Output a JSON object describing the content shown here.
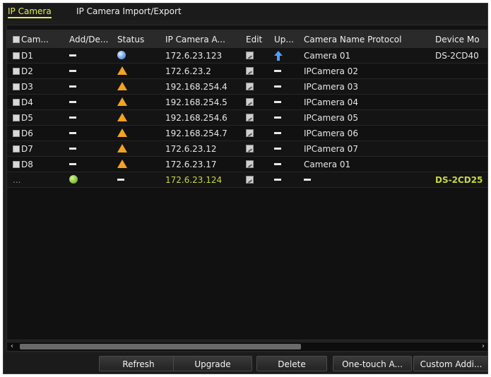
{
  "tabs": [
    {
      "label": "IP Camera",
      "active": true
    },
    {
      "label": "IP Camera Import/Export",
      "active": false
    }
  ],
  "table": {
    "headers": {
      "camera": "Cam...",
      "add_delete": "Add/De...",
      "status": "Status",
      "ip": "IP Camera A...",
      "edit": "Edit",
      "upgrade": "Up...",
      "name": "Camera Name Protocol",
      "model": "Device Mo"
    },
    "rows": [
      {
        "camera": "D1",
        "add": "dash-icon",
        "status": "online-blue-icon",
        "ip": "172.6.23.123",
        "edit": "edit-icon",
        "upgrade": "upgrade-arrow-icon",
        "name": "Camera 01",
        "model": "DS-2CD40"
      },
      {
        "camera": "D2",
        "add": "dash-icon",
        "status": "warning-icon",
        "ip": "172.6.23.2",
        "edit": "edit-icon",
        "upgrade": "dash-icon",
        "name": "IPCamera 02",
        "model": ""
      },
      {
        "camera": "D3",
        "add": "dash-icon",
        "status": "warning-icon",
        "ip": "192.168.254.4",
        "edit": "edit-icon",
        "upgrade": "dash-icon",
        "name": "IPCamera 03",
        "model": ""
      },
      {
        "camera": "D4",
        "add": "dash-icon",
        "status": "warning-icon",
        "ip": "192.168.254.5",
        "edit": "edit-icon",
        "upgrade": "dash-icon",
        "name": "IPCamera 04",
        "model": ""
      },
      {
        "camera": "D5",
        "add": "dash-icon",
        "status": "warning-icon",
        "ip": "192.168.254.6",
        "edit": "edit-icon",
        "upgrade": "dash-icon",
        "name": "IPCamera 05",
        "model": ""
      },
      {
        "camera": "D6",
        "add": "dash-icon",
        "status": "warning-icon",
        "ip": "192.168.254.7",
        "edit": "edit-icon",
        "upgrade": "dash-icon",
        "name": "IPCamera 06",
        "model": ""
      },
      {
        "camera": "D7",
        "add": "dash-icon",
        "status": "warning-icon",
        "ip": "172.6.23.12",
        "edit": "edit-icon",
        "upgrade": "dash-icon",
        "name": "IPCamera 07",
        "model": ""
      },
      {
        "camera": "D8",
        "add": "dash-icon",
        "status": "warning-icon",
        "ip": "172.6.23.17",
        "edit": "edit-icon",
        "upgrade": "dash-icon",
        "name": "Camera 01",
        "model": ""
      }
    ],
    "discovered": {
      "camera": "...",
      "add": "add-green-icon",
      "status": "dash-icon",
      "ip": "172.6.23.124",
      "edit": "edit-icon",
      "upgrade": "dash-icon",
      "name": "dash-icon",
      "model": "DS-2CD25"
    }
  },
  "scrollbar": {
    "left_arrow": "‹",
    "right_arrow": "›"
  },
  "buttons": {
    "refresh": "Refresh",
    "upgrade": "Upgrade",
    "delete": "Delete",
    "one_touch": "One-touch A...",
    "custom": "Custom Addi..."
  },
  "colors": {
    "background": "#1e1e1e",
    "active_tab": "#e6ef4a",
    "discovered_text": "#c8d93a",
    "warning": "#f2a31f",
    "upgrade_arrow": "#4da0ff"
  }
}
